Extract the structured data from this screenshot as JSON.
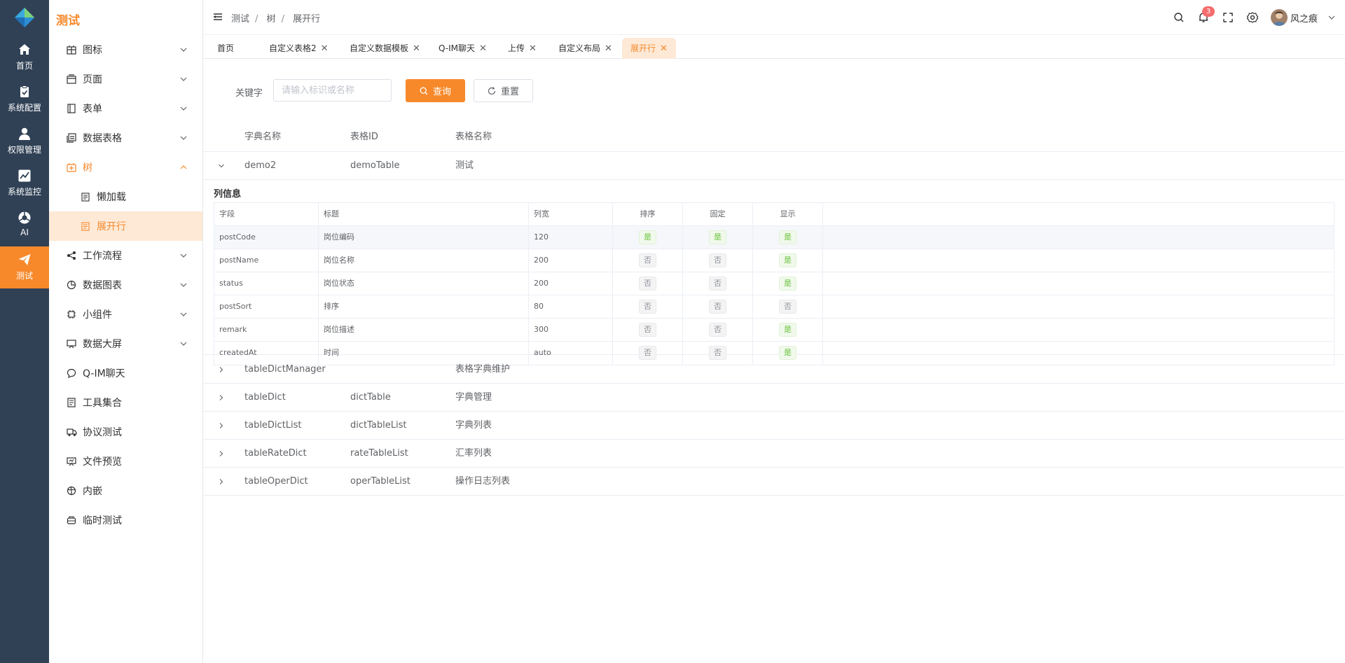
{
  "app": {
    "brand": "测试"
  },
  "rail": [
    {
      "label": "首页",
      "icon": "home-icon"
    },
    {
      "label": "系统配置",
      "icon": "clipboard-icon"
    },
    {
      "label": "权限管理",
      "icon": "user-icon"
    },
    {
      "label": "系统监控",
      "icon": "chart-icon"
    },
    {
      "label": "AI",
      "icon": "ai-icon"
    },
    {
      "label": "测试",
      "icon": "send-icon",
      "active": true
    }
  ],
  "menu": {
    "items": [
      {
        "label": "图标",
        "icon": "icon-grid-icon",
        "arrow": "down"
      },
      {
        "label": "页面",
        "icon": "page-icon",
        "arrow": "down"
      },
      {
        "label": "表单",
        "icon": "form-icon",
        "arrow": "down"
      },
      {
        "label": "数据表格",
        "icon": "table-icon",
        "arrow": "down"
      },
      {
        "label": "树",
        "icon": "tree-icon",
        "arrow": "up",
        "open": true
      },
      {
        "label": "懒加载",
        "icon": "doc-icon",
        "sub": true
      },
      {
        "label": "展开行",
        "icon": "doc-icon",
        "sub": true,
        "selected": true
      },
      {
        "label": "工作流程",
        "icon": "share-icon",
        "arrow": "down"
      },
      {
        "label": "数据图表",
        "icon": "pie-icon",
        "arrow": "down"
      },
      {
        "label": "小组件",
        "icon": "chip-icon",
        "arrow": "down"
      },
      {
        "label": "数据大屏",
        "icon": "screen-icon",
        "arrow": "down"
      },
      {
        "label": "Q-IM聊天",
        "icon": "chat-icon"
      },
      {
        "label": "工具集合",
        "icon": "tools-icon"
      },
      {
        "label": "协议测试",
        "icon": "truck-icon"
      },
      {
        "label": "文件预览",
        "icon": "preview-icon"
      },
      {
        "label": "内嵌",
        "icon": "globe-icon"
      },
      {
        "label": "临时测试",
        "icon": "box-icon"
      }
    ]
  },
  "breadcrumb": [
    "测试",
    "树",
    "展开行"
  ],
  "header": {
    "notification_count": "3",
    "user_name": "风之痕"
  },
  "tabs": [
    {
      "label": "首页",
      "closable": false
    },
    {
      "label": "自定义表格2",
      "closable": true
    },
    {
      "label": "自定义数据模板",
      "closable": true
    },
    {
      "label": "Q-IM聊天",
      "closable": true
    },
    {
      "label": "上传",
      "closable": true
    },
    {
      "label": "自定义布局",
      "closable": true
    },
    {
      "label": "展开行",
      "closable": true,
      "active": true
    }
  ],
  "filter": {
    "keyword_label": "关键字",
    "keyword_placeholder": "请输入标识或名称",
    "keyword_value": "",
    "search_label": "查询",
    "reset_label": "重置"
  },
  "table": {
    "columns": [
      "字典名称",
      "表格ID",
      "表格名称"
    ],
    "rows": [
      {
        "name": "demo2",
        "id": "demoTable",
        "title": "测试",
        "expanded": true
      },
      {
        "name": "tableDictManager",
        "id": "",
        "title": "表格字典维护",
        "expanded": false
      },
      {
        "name": "tableDict",
        "id": "dictTable",
        "title": "字典管理",
        "expanded": false
      },
      {
        "name": "tableDictList",
        "id": "dictTableList",
        "title": "字典列表",
        "expanded": false
      },
      {
        "name": "tableRateDict",
        "id": "rateTableList",
        "title": "汇率列表",
        "expanded": false
      },
      {
        "name": "tableOperDict",
        "id": "operTableList",
        "title": "操作日志列表",
        "expanded": false
      }
    ],
    "expanded_detail": {
      "title": "列信息",
      "columns": [
        "字段",
        "标题",
        "列宽",
        "排序",
        "固定",
        "显示"
      ],
      "yes_label": "是",
      "no_label": "否",
      "rows": [
        {
          "field": "postCode",
          "title": "岗位编码",
          "width": "120",
          "sort": true,
          "fixed": true,
          "show": true
        },
        {
          "field": "postName",
          "title": "岗位名称",
          "width": "200",
          "sort": false,
          "fixed": false,
          "show": true
        },
        {
          "field": "status",
          "title": "岗位状态",
          "width": "200",
          "sort": false,
          "fixed": false,
          "show": true
        },
        {
          "field": "postSort",
          "title": "排序",
          "width": "80",
          "sort": false,
          "fixed": false,
          "show": false
        },
        {
          "field": "remark",
          "title": "岗位描述",
          "width": "300",
          "sort": false,
          "fixed": false,
          "show": true
        },
        {
          "field": "createdAt",
          "title": "时间",
          "width": "auto",
          "sort": false,
          "fixed": false,
          "show": true
        }
      ]
    }
  },
  "colors": {
    "accent": "#f7892b",
    "rail_bg": "#304156",
    "selected_bg": "#fde9d6",
    "yes": "#67c23a"
  }
}
